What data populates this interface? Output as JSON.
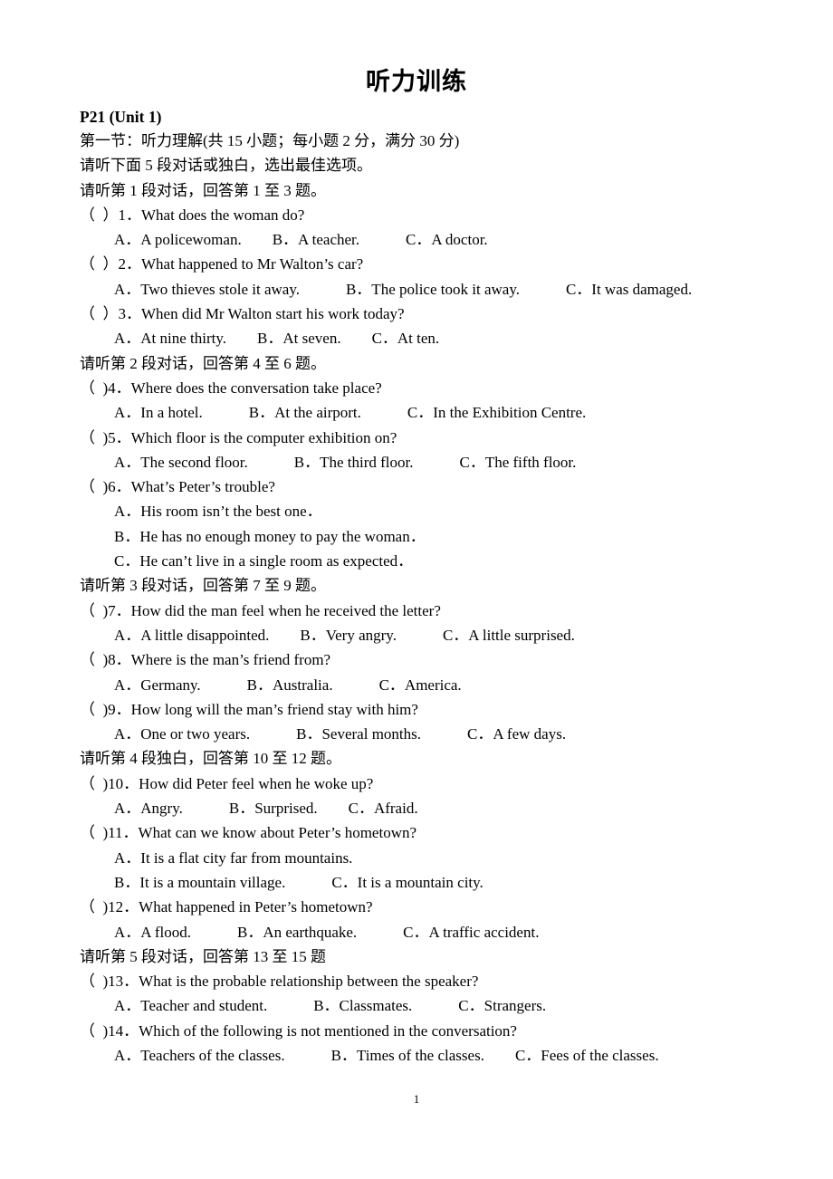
{
  "document": {
    "title": "听力训练",
    "page_number": "1",
    "section_heading": "P21 (Unit 1)",
    "intro_lines": [
      "第一节：听力理解(共 15 小题；每小题 2 分，满分 30 分)",
      "请听下面 5 段对话或独白，选出最佳选项。"
    ]
  },
  "blocks": [
    {
      "direction": "请听第 1 段对话，回答第 1 至 3 题。",
      "questions": [
        {
          "stem": "（  ）1．What does the woman do?",
          "option_lines": [
            "A．A policewoman.　　B．A teacher.　　　C．A doctor."
          ]
        },
        {
          "stem": "（  ）2．What happened to Mr Walton’s car?",
          "option_lines": [
            "A．Two thieves stole it away.　　　B．The police took it away.　　　C．It was damaged."
          ]
        },
        {
          "stem": "（  ）3．When did Mr Walton start his work today?",
          "option_lines": [
            "A．At nine thirty.　　B．At seven.　　C．At ten."
          ]
        }
      ]
    },
    {
      "direction": "请听第 2 段对话，回答第 4 至 6 题。",
      "questions": [
        {
          "stem": "（  )4．Where does the conversation take place?",
          "option_lines": [
            "A．In a hotel.　　　B．At the airport.　　　C．In the Exhibition Centre."
          ]
        },
        {
          "stem": "（  )5．Which floor is the computer exhibition on?",
          "option_lines": [
            "A．The second floor.　　　B．The third floor.　　　C．The fifth floor."
          ]
        },
        {
          "stem": "（  )6．What’s Peter’s trouble?",
          "option_lines": [
            "A．His room isn’t the best one．",
            "B．He has no enough money to pay the woman．",
            "C．He can’t live in a single room as expected．"
          ]
        }
      ]
    },
    {
      "direction": "请听第 3 段对话，回答第 7 至 9 题。",
      "questions": [
        {
          "stem": "（  )7．How did the man feel when he received the letter?",
          "option_lines": [
            "A．A little disappointed.　　B．Very angry.　　　C．A little surprised."
          ]
        },
        {
          "stem": "（  )8．Where is the man’s friend from?",
          "option_lines": [
            "A．Germany.　　　B．Australia.　　　C．America."
          ]
        },
        {
          "stem": "（  )9．How long will the man’s friend stay with him?",
          "option_lines": [
            "A．One or two years.　　　B．Several months.　　　C．A few days."
          ]
        }
      ]
    },
    {
      "direction": "请听第 4 段独白，回答第 10 至 12 题。",
      "questions": [
        {
          "stem": "（  )10．How did Peter feel when he woke up?",
          "option_lines": [
            "A．Angry.　　　B．Surprised.　　C．Afraid."
          ]
        },
        {
          "stem": "（  )11．What can we know about Peter’s hometown?",
          "option_lines": [
            "A．It is a flat city far from mountains.",
            "B．It is a mountain village.　　　C．It is a mountain city."
          ]
        },
        {
          "stem": "（  )12．What happened in Peter’s hometown?",
          "option_lines": [
            "A．A flood.　　　B．An earthquake.　　　C．A traffic accident."
          ]
        }
      ]
    },
    {
      "direction": "请听第 5 段对话，回答第 13 至 15 题",
      "questions": [
        {
          "stem": "（  )13．What is the probable relationship between the speaker?",
          "option_lines": [
            "A．Teacher and student.　　　B．Classmates.　　　C．Strangers."
          ]
        },
        {
          "stem": "（  )14．Which of the following is not mentioned in the conversation?",
          "option_lines": [
            "A．Teachers of the classes.　　　B．Times of the classes.　　C．Fees of the classes."
          ]
        }
      ]
    }
  ]
}
